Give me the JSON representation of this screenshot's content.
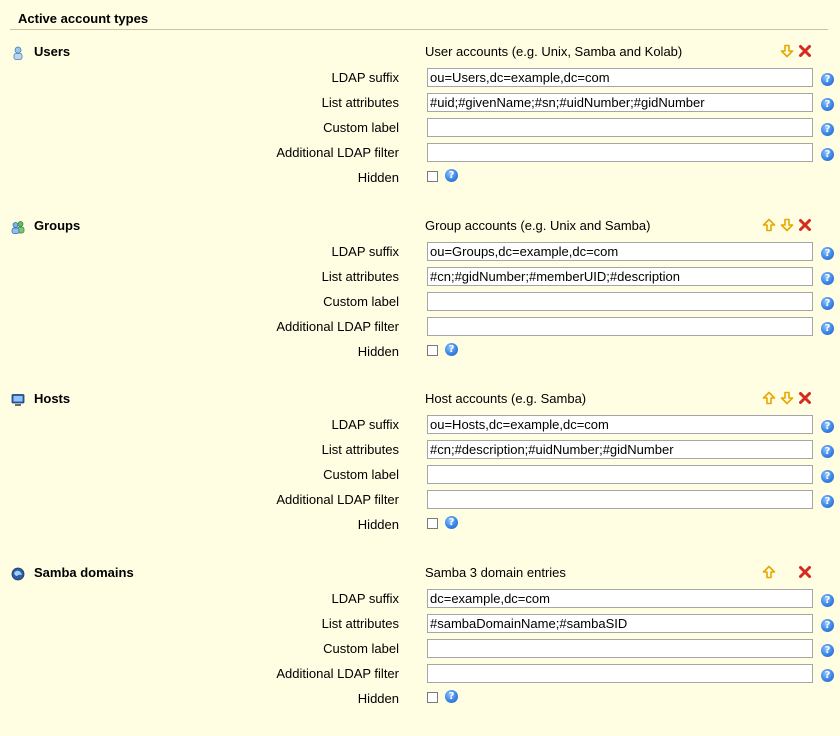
{
  "section_title": "Active account types",
  "account_types": [
    {
      "name": "Users",
      "icon": "user-icon",
      "description": "User accounts (e.g. Unix, Samba and Kolab)",
      "controls": [
        "down",
        "delete"
      ],
      "fields": {
        "ldap_suffix_label": "LDAP suffix",
        "ldap_suffix": "ou=Users,dc=example,dc=com",
        "list_attributes_label": "List attributes",
        "list_attributes": "#uid;#givenName;#sn;#uidNumber;#gidNumber",
        "custom_label_label": "Custom label",
        "custom_label": "",
        "ldap_filter_label": "Additional LDAP filter",
        "ldap_filter": "",
        "hidden_label": "Hidden",
        "hidden": false
      }
    },
    {
      "name": "Groups",
      "icon": "group-icon",
      "description": "Group accounts (e.g. Unix and Samba)",
      "controls": [
        "up",
        "down",
        "delete"
      ],
      "fields": {
        "ldap_suffix_label": "LDAP suffix",
        "ldap_suffix": "ou=Groups,dc=example,dc=com",
        "list_attributes_label": "List attributes",
        "list_attributes": "#cn;#gidNumber;#memberUID;#description",
        "custom_label_label": "Custom label",
        "custom_label": "",
        "ldap_filter_label": "Additional LDAP filter",
        "ldap_filter": "",
        "hidden_label": "Hidden",
        "hidden": false
      }
    },
    {
      "name": "Hosts",
      "icon": "host-icon",
      "description": "Host accounts (e.g. Samba)",
      "controls": [
        "up",
        "down",
        "delete"
      ],
      "fields": {
        "ldap_suffix_label": "LDAP suffix",
        "ldap_suffix": "ou=Hosts,dc=example,dc=com",
        "list_attributes_label": "List attributes",
        "list_attributes": "#cn;#description;#uidNumber;#gidNumber",
        "custom_label_label": "Custom label",
        "custom_label": "",
        "ldap_filter_label": "Additional LDAP filter",
        "ldap_filter": "",
        "hidden_label": "Hidden",
        "hidden": false
      }
    },
    {
      "name": "Samba domains",
      "icon": "samba-domain-icon",
      "description": "Samba 3 domain entries",
      "controls": [
        "up",
        "delete"
      ],
      "fields": {
        "ldap_suffix_label": "LDAP suffix",
        "ldap_suffix": "dc=example,dc=com",
        "list_attributes_label": "List attributes",
        "list_attributes": "#sambaDomainName;#sambaSID",
        "custom_label_label": "Custom label",
        "custom_label": "",
        "ldap_filter_label": "Additional LDAP filter",
        "ldap_filter": "",
        "hidden_label": "Hidden",
        "hidden": false
      }
    }
  ],
  "colors": {
    "background": "#fffde2",
    "arrow": "#e6a800",
    "delete": "#d62a1e",
    "help": "#3a84e6"
  }
}
